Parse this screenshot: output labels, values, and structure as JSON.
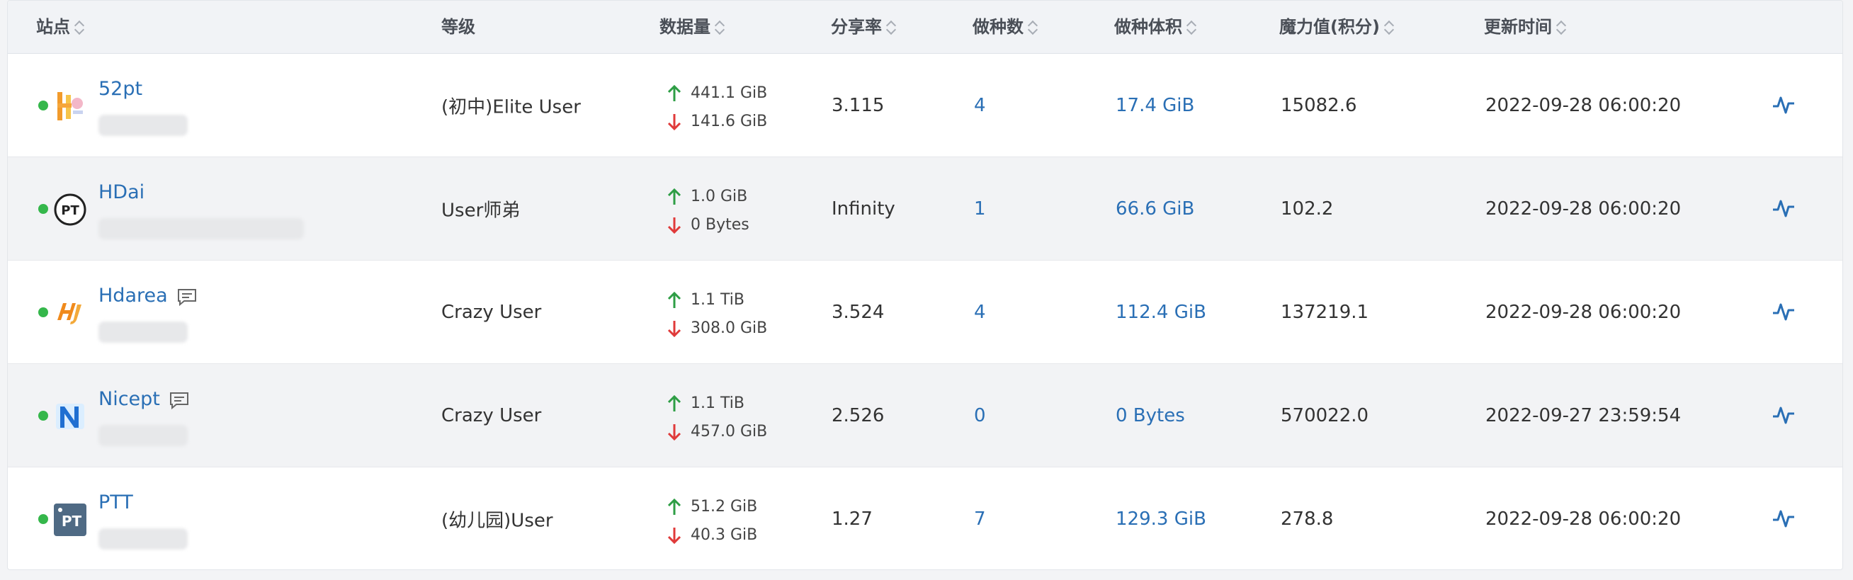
{
  "header": {
    "site": "站点",
    "level": "等级",
    "data_volume": "数据量",
    "share_ratio": "分享率",
    "seeding_count": "做种数",
    "seeding_size": "做种体积",
    "bonus": "魔力值(积分)",
    "updated": "更新时间"
  },
  "rows": [
    {
      "site": "52pt",
      "logo": "52pt-logo-icon",
      "online": true,
      "has_message": false,
      "level": "(初中)Elite User",
      "upload": "441.1 GiB",
      "download": "141.6 GiB",
      "ratio": "3.115",
      "seeding_count": "4",
      "seeding_size": "17.4 GiB",
      "bonus": "15082.6",
      "updated": "2022-09-28 06:00:20"
    },
    {
      "site": "HDai",
      "logo": "pt-circle-logo-icon",
      "online": true,
      "has_message": false,
      "level": "User师弟",
      "upload": "1.0 GiB",
      "download": "0 Bytes",
      "ratio": "Infinity",
      "seeding_count": "1",
      "seeding_size": "66.6 GiB",
      "bonus": "102.2",
      "updated": "2022-09-28 06:00:20"
    },
    {
      "site": "Hdarea",
      "logo": "hdarea-logo-icon",
      "online": true,
      "has_message": true,
      "level": "Crazy User",
      "upload": "1.1 TiB",
      "download": "308.0 GiB",
      "ratio": "3.524",
      "seeding_count": "4",
      "seeding_size": "112.4 GiB",
      "bonus": "137219.1",
      "updated": "2022-09-28 06:00:20"
    },
    {
      "site": "Nicept",
      "logo": "nicept-logo-icon",
      "online": true,
      "has_message": true,
      "level": "Crazy User",
      "upload": "1.1 TiB",
      "download": "457.0 GiB",
      "ratio": "2.526",
      "seeding_count": "0",
      "seeding_size": "0 Bytes",
      "bonus": "570022.0",
      "updated": "2022-09-27 23:59:54"
    },
    {
      "site": "PTT",
      "logo": "ptt-logo-icon",
      "online": true,
      "has_message": false,
      "level": "(幼儿园)User",
      "upload": "51.2 GiB",
      "download": "40.3 GiB",
      "ratio": "1.27",
      "seeding_count": "7",
      "seeding_size": "129.3 GiB",
      "bonus": "278.8",
      "updated": "2022-09-28 06:00:20"
    }
  ],
  "colors": {
    "link": "#2a6fb5",
    "online": "#35b74b",
    "upload_arrow": "#2e9e45",
    "download_arrow": "#e03a3a"
  }
}
